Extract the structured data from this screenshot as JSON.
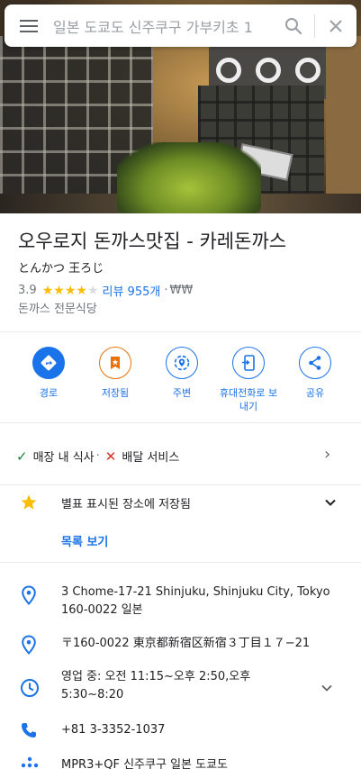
{
  "search": {
    "query": "일본 도쿄도 신주쿠구 가부키초 1"
  },
  "place": {
    "name": "오우로지 돈까스맛집 - 카레돈까스",
    "native_name": "とんかつ 王ろじ",
    "rating": "3.9",
    "stars": 4,
    "reviews_label": "리뷰 955개",
    "price_separator": "·",
    "price": "₩₩",
    "category": "돈까스 전문식당"
  },
  "actions": [
    {
      "label": "경로",
      "icon": "directions-icon"
    },
    {
      "label": "저장됨",
      "icon": "bookmark-icon"
    },
    {
      "label": "주변",
      "icon": "nearby-icon"
    },
    {
      "label": "휴대전화로 보내기",
      "icon": "send-to-phone-icon"
    },
    {
      "label": "공유",
      "icon": "share-icon"
    }
  ],
  "services": {
    "dine_in": "매장 내 식사",
    "sep": "·",
    "delivery": "배달 서비스"
  },
  "saved": {
    "text": "별표 표시된 장소에 저장됨",
    "view_list": "목록 보기"
  },
  "info": {
    "address": "3 Chome-17-21 Shinjuku, Shinjuku City, Tokyo 160-0022 일본",
    "address_ja": "〒160-0022 東京都新宿区新宿３丁目１７−21",
    "hours": "영업 중:  오전 11:15~오후 2:50,오후 5:30~8:20",
    "phone": "+81 3-3352-1037",
    "plus_code": "MPR3+QF 신주쿠구 일본 도쿄도"
  },
  "colors": {
    "accent": "#1a73e8",
    "star": "#fbbc04",
    "saved_orange": "#e8710a",
    "check_green": "#188038",
    "cross_red": "#d93025"
  }
}
